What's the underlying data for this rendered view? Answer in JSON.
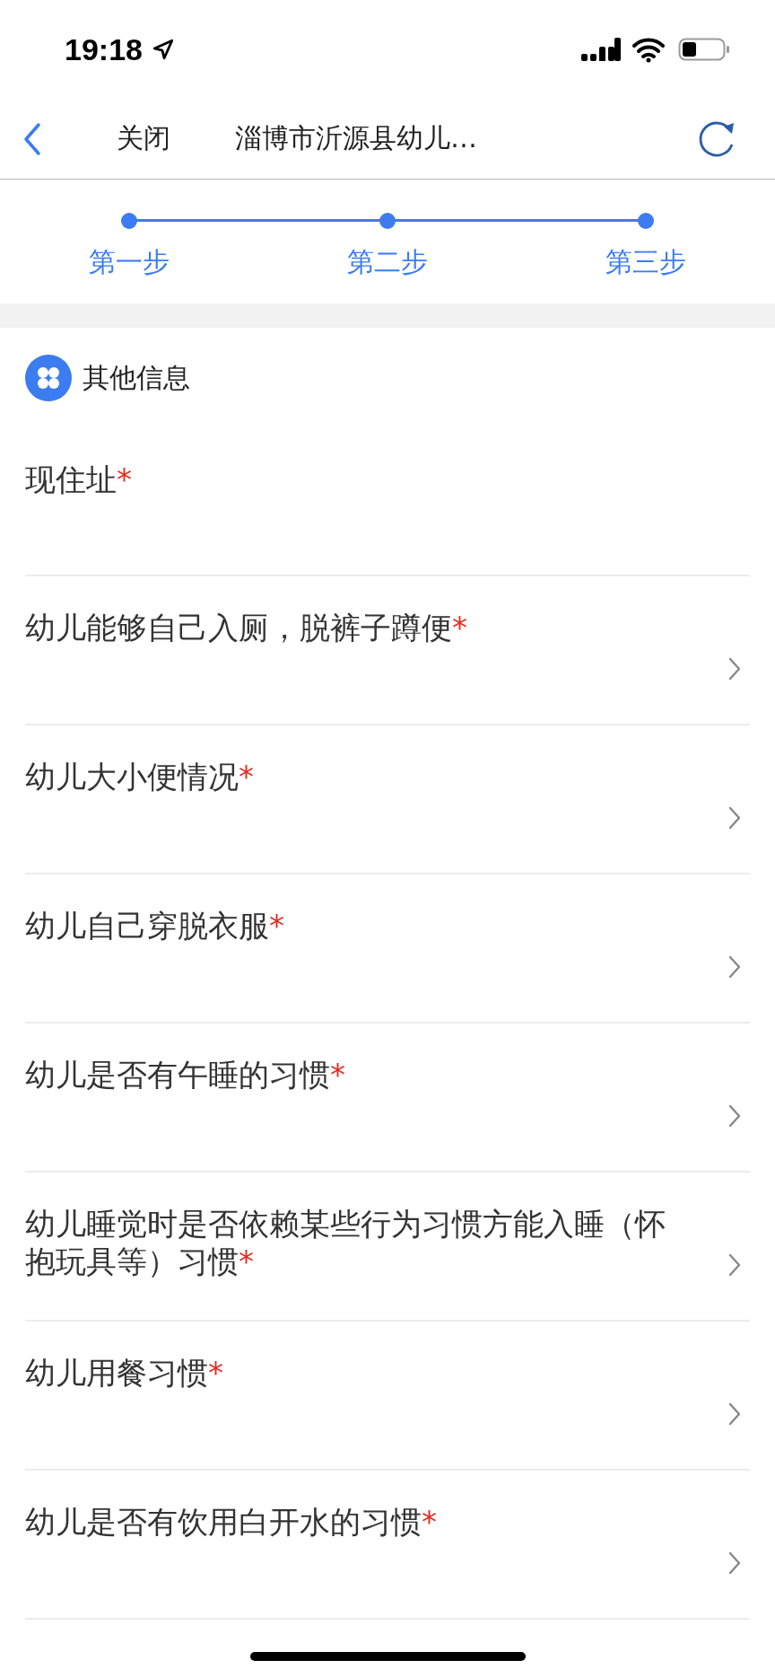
{
  "status_bar": {
    "time": "19:18"
  },
  "nav": {
    "close": "关闭",
    "title": "淄博市沂源县幼儿…"
  },
  "steps": [
    {
      "label": "第一步"
    },
    {
      "label": "第二步"
    },
    {
      "label": "第三步"
    }
  ],
  "section": {
    "title": "其他信息"
  },
  "fields": [
    {
      "kind": "text",
      "label": "现住址",
      "mark": "*"
    },
    {
      "kind": "select",
      "label": "幼儿能够自己入厕，脱裤子蹲便",
      "mark": "*"
    },
    {
      "kind": "select",
      "label": "幼儿大小便情况",
      "mark": "*"
    },
    {
      "kind": "select",
      "label": "幼儿自己穿脱衣服",
      "mark": "*"
    },
    {
      "kind": "select",
      "label": "幼儿是否有午睡的习惯",
      "mark": "*"
    },
    {
      "kind": "select",
      "label": "幼儿睡觉时是否依赖某些行为习惯方能入睡（怀抱玩具等）习惯",
      "mark": "*"
    },
    {
      "kind": "select",
      "label": "幼儿用餐习惯",
      "mark": "*"
    },
    {
      "kind": "select",
      "label": "幼儿是否有饮用白开水的习惯",
      "mark": "*"
    }
  ]
}
